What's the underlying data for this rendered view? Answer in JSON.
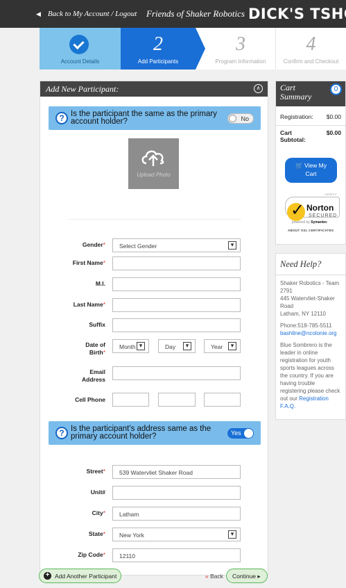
{
  "topbar": {
    "back_label": "Back to My Account / Logout",
    "org_name": "Friends of Shaker Robotics",
    "brand": "DICK'S TSHO"
  },
  "steps": [
    {
      "number": "",
      "label": "Account Details",
      "state": "complete"
    },
    {
      "number": "2",
      "label": "Add Participants",
      "state": "active"
    },
    {
      "number": "3",
      "label": "Program Information",
      "state": "upcoming"
    },
    {
      "number": "4",
      "label": "Confirm and Checkout",
      "state": "upcoming"
    }
  ],
  "form": {
    "title": "Add New Participant:",
    "same_as_primary_question": "Is the participant the same as the primary account holder?",
    "same_as_primary_toggle": "No",
    "upload_photo_label": "Upload Photo",
    "fields": {
      "gender": {
        "label": "Gender",
        "value": "Select Gender"
      },
      "first_name": {
        "label": "First Name",
        "value": ""
      },
      "mi": {
        "label": "M.I.",
        "value": ""
      },
      "last_name": {
        "label": "Last Name",
        "value": ""
      },
      "suffix": {
        "label": "Suffix",
        "value": ""
      },
      "dob": {
        "label_line1": "Date of",
        "label_line2": "Birth",
        "month": "Month",
        "day": "Day",
        "year": "Year"
      },
      "email": {
        "label_line1": "Email",
        "label_line2": "Address",
        "value": ""
      },
      "cell_phone": {
        "label": "Cell Phone"
      }
    },
    "address_question": "Is the participant's address same as the primary account holder?",
    "address_toggle": "Yes",
    "address": {
      "street": {
        "label": "Street",
        "value": "539 Watervliet Shaker Road"
      },
      "unit": {
        "label": "Unit#",
        "value": ""
      },
      "city": {
        "label": "City",
        "value": "Latham"
      },
      "state": {
        "label": "State",
        "value": "New York"
      },
      "zip": {
        "label": "Zip Code",
        "value": "12110"
      }
    },
    "required_mark": "*"
  },
  "buttons": {
    "add_another": "Add Another Participant",
    "back": "Back",
    "back_chevron": "«",
    "continue": "Continue ▸"
  },
  "cart": {
    "title_line1": "Cart",
    "title_line2": "Summary",
    "count": "0",
    "registration_label": "Registration:",
    "registration_value": "$0.00",
    "subtotal_label_line1": "Cart",
    "subtotal_label_line2": "Subtotal:",
    "subtotal_value": "$0.00",
    "view_cart_line1": "View My",
    "view_cart_line2": "Cart"
  },
  "norton": {
    "verify": "VERIFY",
    "name": "Norton",
    "secured": "SECURED",
    "powered_by": "powered by",
    "symantec": "Symantec",
    "about": "ABOUT SSL CERTIFICATES"
  },
  "help": {
    "title": "Need Help?",
    "address_line1": "Shaker Robotics - Team 2791",
    "address_line2": "445 Watervliet-Shaker Road",
    "address_line3": "Latham, NY 12110",
    "phone": "Phone:518-785-5511",
    "email": "bashline@ncolonie.org",
    "blurb": "Blue Sombrero is the leader in online registration for youth sports leagues across the country. If you are having trouble registering please check out our",
    "faq_link": "Registration F.A.Q."
  },
  "colors": {
    "accent": "#1a6fd6",
    "step_done": "#7ec3ec",
    "required": "#d9362b",
    "green_button": "#5cb85c"
  }
}
